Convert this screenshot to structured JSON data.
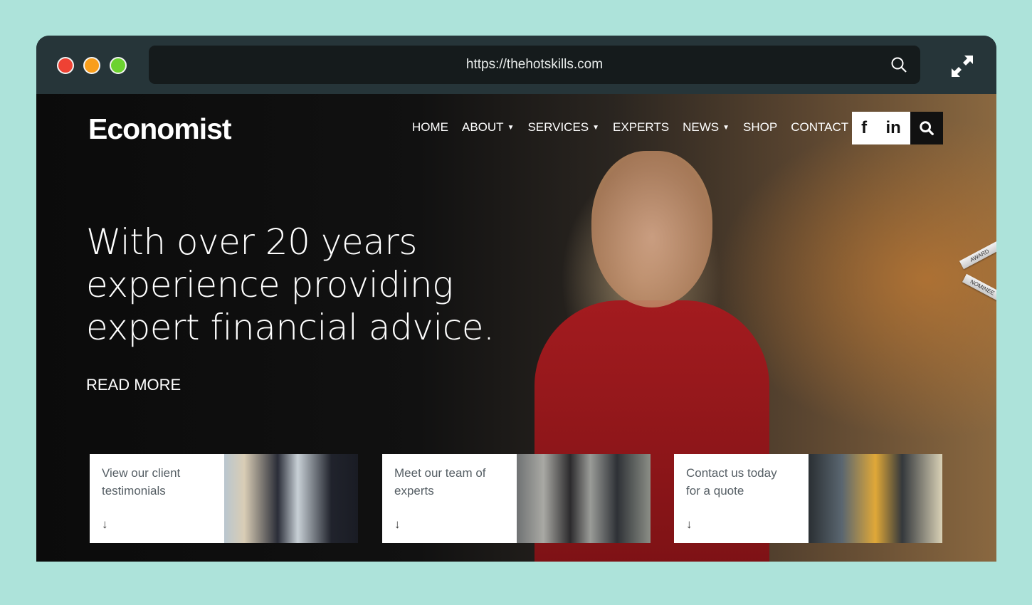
{
  "browser": {
    "url": "https://thehotskills.com",
    "dots": [
      "#ee4234",
      "#f99e1b",
      "#6cd230"
    ]
  },
  "site": {
    "logo": "Economist",
    "nav": [
      {
        "label": "HOME"
      },
      {
        "label": "ABOUT",
        "dropdown": true
      },
      {
        "label": "SERVICES",
        "dropdown": true
      },
      {
        "label": "EXPERTS"
      },
      {
        "label": "NEWS",
        "dropdown": true
      },
      {
        "label": "SHOP"
      },
      {
        "label": "CONTACT"
      }
    ],
    "social": {
      "facebook": "f",
      "linkedin": "in"
    },
    "hero": {
      "line1": "With over 20 years",
      "line2": "experience providing",
      "line3": "expert financial advice.",
      "cta": "READ MORE"
    },
    "badge": {
      "top": "AWARD",
      "bottom": "NOMINEE"
    },
    "cards": [
      {
        "line1": "View our client",
        "line2": "testimonials",
        "arrow": "↓"
      },
      {
        "line1": "Meet our team of",
        "line2": "experts",
        "arrow": "↓"
      },
      {
        "line1": "Contact us today",
        "line2": "for a quote",
        "arrow": "↓"
      }
    ]
  }
}
